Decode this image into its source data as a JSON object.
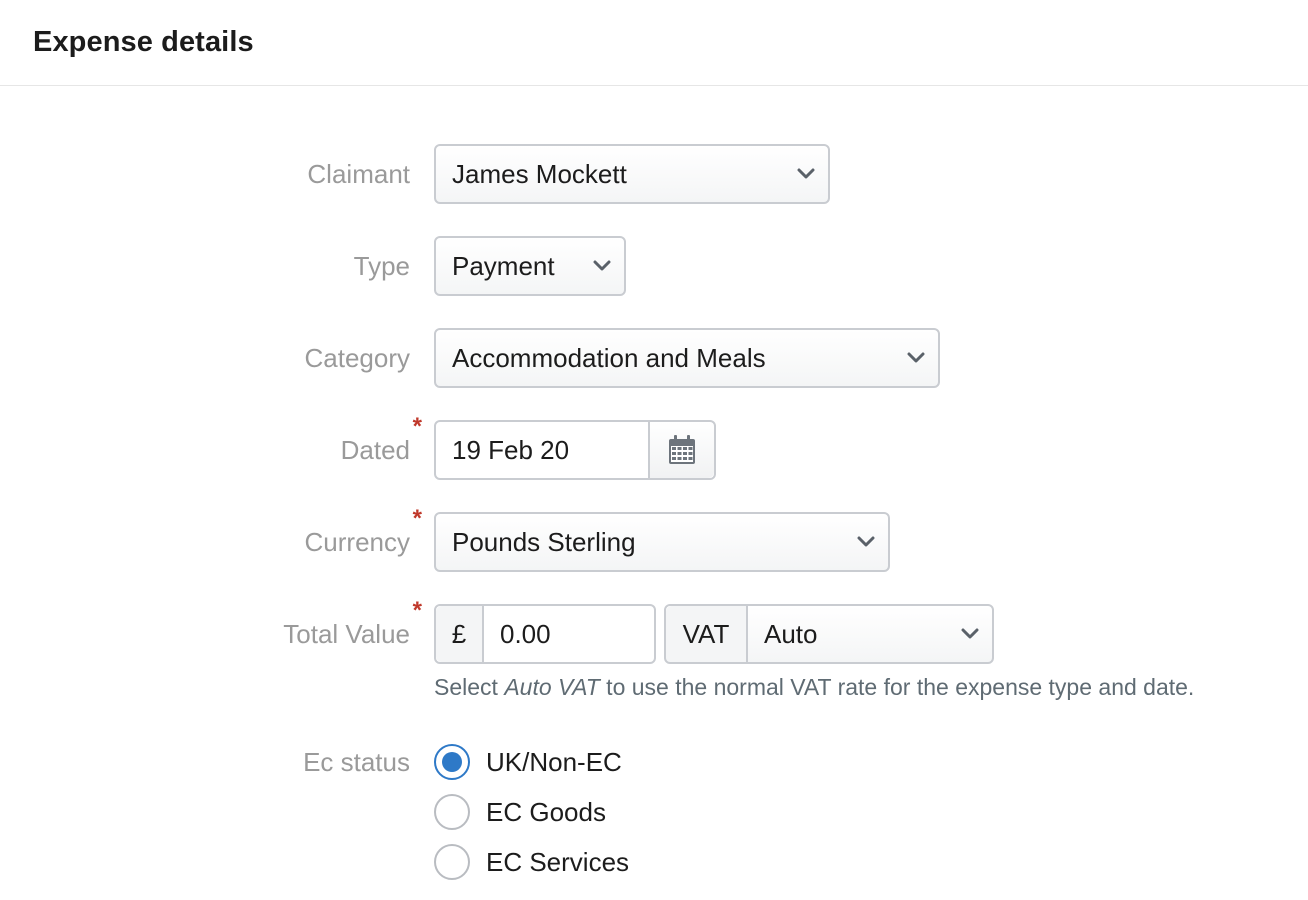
{
  "header": {
    "title": "Expense details"
  },
  "form": {
    "claimant": {
      "label": "Claimant",
      "value": "James Mockett"
    },
    "type": {
      "label": "Type",
      "value": "Payment"
    },
    "category": {
      "label": "Category",
      "value": "Accommodation and Meals"
    },
    "dated": {
      "label": "Dated",
      "value": "19 Feb 20",
      "required": "*"
    },
    "currency": {
      "label": "Currency",
      "value": "Pounds Sterling",
      "required": "*"
    },
    "total_value": {
      "label": "Total Value",
      "required": "*",
      "currency_symbol": "£",
      "amount": "0.00",
      "vat_label": "VAT",
      "vat_value": "Auto"
    },
    "help": {
      "prefix": "Select ",
      "emphasis": "Auto VAT",
      "suffix": " to use the normal VAT rate for the expense type and date."
    },
    "ec_status": {
      "label": "Ec status",
      "options": [
        {
          "label": "UK/Non-EC",
          "checked": true
        },
        {
          "label": "EC Goods",
          "checked": false
        },
        {
          "label": "EC Services",
          "checked": false
        }
      ]
    }
  },
  "colors": {
    "accent": "#2e79c7",
    "required": "#c0392b",
    "label": "#9a9a9a",
    "border": "#c9ccd1"
  }
}
